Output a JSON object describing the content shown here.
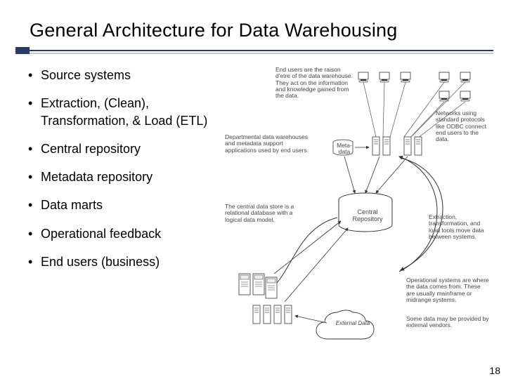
{
  "title": "General Architecture for Data Warehousing",
  "bullets": [
    "Source systems",
    "Extraction, (Clean), Transformation, & Load (ETL)",
    "Central repository",
    "Metadata repository",
    "Data marts",
    "Operational feedback",
    "End users (business)"
  ],
  "diagram": {
    "end_users_note": "End users are the raison d'etre of the data warehouse. They act on the information and knowledge gained from the data.",
    "networks_note": "Networks using standard protocols like ODBC connect end users to the data.",
    "dept_dw_note": "Departmental data warehouses and metadata support applications used by end users.",
    "metadata_label": "Meta-data",
    "central_repo_note": "The central data store is a relational database with a logical data model.",
    "central_repo_label": "Central Repository",
    "etl_note": "Extraction, transformation, and load tools move data between systems.",
    "operational_note": "Operational systems are where the data comes from. These are usually mainframe or midrange systems.",
    "external_note": "Some data may be provided by external vendors.",
    "external_label": "External Data"
  },
  "page_number": "18"
}
